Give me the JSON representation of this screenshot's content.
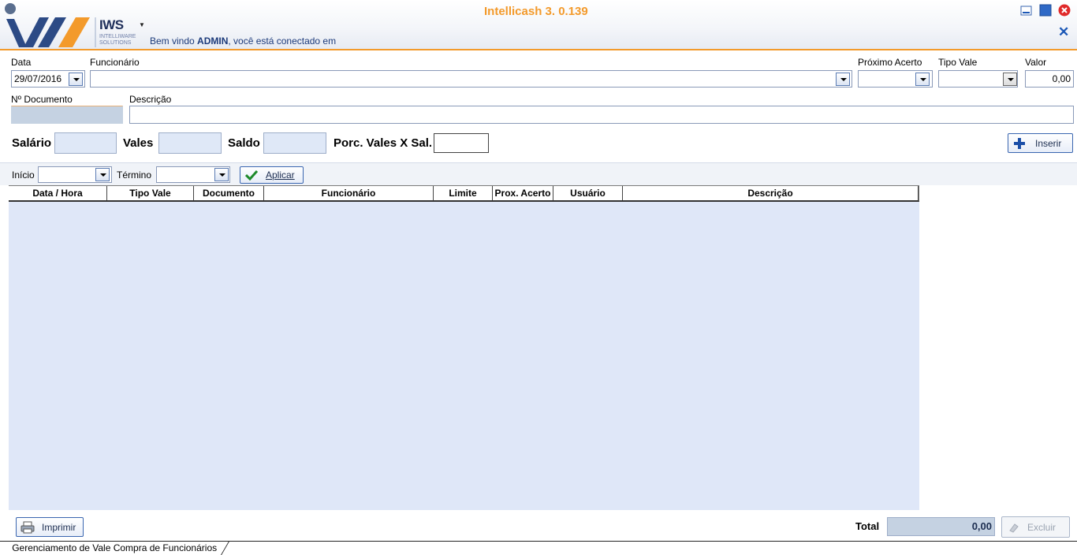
{
  "header": {
    "app_title": "Intellicash 3. 0.139",
    "logo_text": "IWS",
    "logo_sub_1": "INTELLIWARE",
    "logo_sub_2": "SOLUTIONS",
    "welcome_prefix": "Bem vindo ",
    "welcome_user": "ADMIN",
    "welcome_suffix": ", você está conectado em"
  },
  "form": {
    "data_label": "Data",
    "data_value": "29/07/2016",
    "funcionario_label": "Funcionário",
    "funcionario_value": "",
    "proximo_acerto_label": "Próximo Acerto",
    "tipo_vale_label": "Tipo Vale",
    "valor_label": "Valor",
    "valor_value": "0,00",
    "documento_label": "Nº Documento",
    "descricao_label": "Descrição"
  },
  "summary": {
    "salario_label": "Salário",
    "vales_label": "Vales",
    "saldo_label": "Saldo",
    "porc_label": "Porc. Vales X Sal.",
    "inserir_label": "Inserir"
  },
  "filter": {
    "inicio_label": "Início",
    "termino_label": "Término",
    "aplicar_label": "Aplicar"
  },
  "grid": {
    "columns": [
      "Data / Hora",
      "Tipo Vale",
      "Documento",
      "Funcionário",
      "Limite",
      "Prox. Acerto",
      "Usuário",
      "Descrição"
    ],
    "rows": []
  },
  "footer": {
    "imprimir_label": "Imprimir",
    "total_label": "Total",
    "total_value": "0,00",
    "excluir_label": "Excluir",
    "status_tab": "Gerenciamento de Vale Compra de Funcionários"
  },
  "colors": {
    "accent_orange": "#f39a2b",
    "brand_blue": "#1f2f5a",
    "grid_bg": "#dfe7f8"
  }
}
